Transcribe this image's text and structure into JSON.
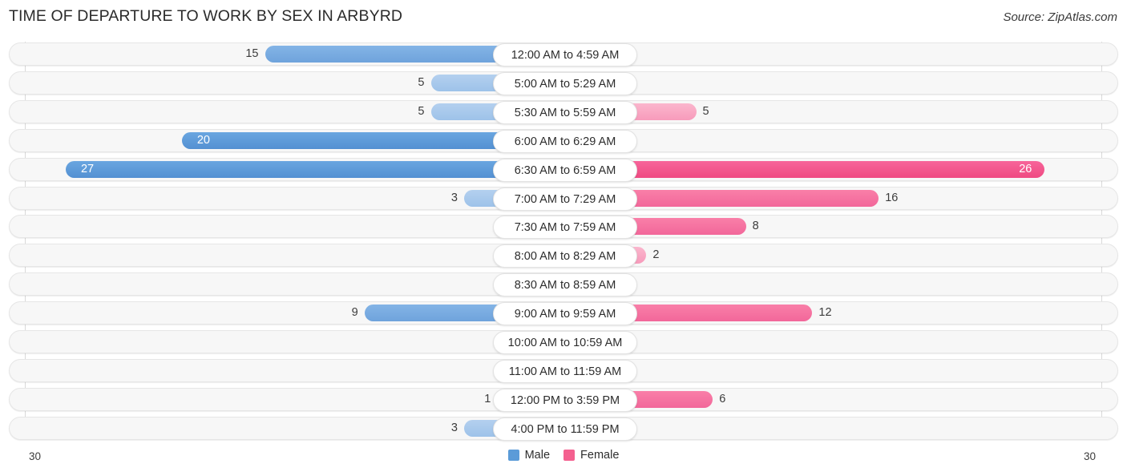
{
  "header": {
    "title": "TIME OF DEPARTURE TO WORK BY SEX IN ARBYRD",
    "source": "Source: ZipAtlas.com"
  },
  "axis": {
    "left_tick": "30",
    "right_tick": "30"
  },
  "legend": {
    "male_label": "Male",
    "female_label": "Female",
    "male_color": "#5b9bd8",
    "female_color": "#f4608f"
  },
  "chart_data": {
    "type": "bar",
    "title": "TIME OF DEPARTURE TO WORK BY SEX IN ARBYRD",
    "subtitle": "",
    "xlabel": "",
    "ylabel": "",
    "orientation": "horizontal-diverging",
    "grid": false,
    "legend_position": "bottom-center",
    "axis_max": 30,
    "xlim": [
      30,
      30
    ],
    "categories": [
      "12:00 AM to 4:59 AM",
      "5:00 AM to 5:29 AM",
      "5:30 AM to 5:59 AM",
      "6:00 AM to 6:29 AM",
      "6:30 AM to 6:59 AM",
      "7:00 AM to 7:29 AM",
      "7:30 AM to 7:59 AM",
      "8:00 AM to 8:29 AM",
      "8:30 AM to 8:59 AM",
      "9:00 AM to 9:59 AM",
      "10:00 AM to 10:59 AM",
      "11:00 AM to 11:59 AM",
      "12:00 PM to 3:59 PM",
      "4:00 PM to 11:59 PM"
    ],
    "series": [
      {
        "name": "Male",
        "values": [
          15,
          5,
          5,
          20,
          27,
          3,
          0,
          0,
          0,
          9,
          0,
          0,
          1,
          3
        ]
      },
      {
        "name": "Female",
        "values": [
          0,
          0,
          5,
          0,
          26,
          16,
          8,
          2,
          0,
          12,
          0,
          0,
          6,
          0
        ]
      }
    ]
  },
  "rows": [
    {
      "label": "12:00 AM to 4:59 AM",
      "male": "15",
      "female": "0"
    },
    {
      "label": "5:00 AM to 5:29 AM",
      "male": "5",
      "female": "0"
    },
    {
      "label": "5:30 AM to 5:59 AM",
      "male": "5",
      "female": "5"
    },
    {
      "label": "6:00 AM to 6:29 AM",
      "male": "20",
      "female": "0"
    },
    {
      "label": "6:30 AM to 6:59 AM",
      "male": "27",
      "female": "26"
    },
    {
      "label": "7:00 AM to 7:29 AM",
      "male": "3",
      "female": "16"
    },
    {
      "label": "7:30 AM to 7:59 AM",
      "male": "0",
      "female": "8"
    },
    {
      "label": "8:00 AM to 8:29 AM",
      "male": "0",
      "female": "2"
    },
    {
      "label": "8:30 AM to 8:59 AM",
      "male": "0",
      "female": "0"
    },
    {
      "label": "9:00 AM to 9:59 AM",
      "male": "9",
      "female": "12"
    },
    {
      "label": "10:00 AM to 10:59 AM",
      "male": "0",
      "female": "0"
    },
    {
      "label": "11:00 AM to 11:59 AM",
      "male": "0",
      "female": "0"
    },
    {
      "label": "12:00 PM to 3:59 PM",
      "male": "1",
      "female": "6"
    },
    {
      "label": "4:00 PM to 11:59 PM",
      "male": "3",
      "female": "0"
    }
  ]
}
